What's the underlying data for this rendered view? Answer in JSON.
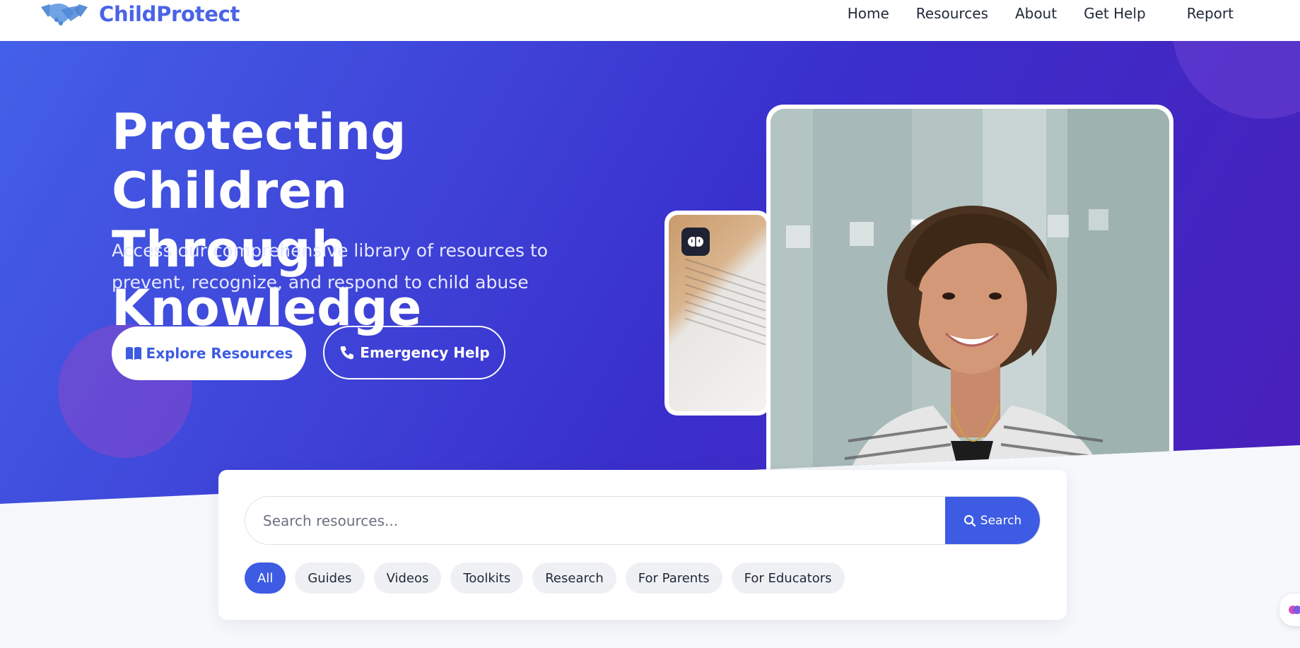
{
  "header": {
    "brand_name": "ChildProtect",
    "logo_icon": "handshake-icon",
    "nav": [
      {
        "label": "Home"
      },
      {
        "label": "Resources"
      },
      {
        "label": "About"
      },
      {
        "label": "Get Help"
      },
      {
        "label": "Report"
      }
    ]
  },
  "hero": {
    "title_line1": "Protecting Children",
    "title_line2": "Through Knowledge",
    "subtitle": "Access our comprehensive library of resources to prevent, recognize, and respond to child abuse",
    "explore_label": "Explore Resources",
    "explore_icon": "book-open-icon",
    "emergency_label": "Emergency Help",
    "emergency_icon": "phone-icon",
    "doc_badge_icon": "brain-icon",
    "colors": {
      "gradient_start": "#4460e8",
      "gradient_end": "#4a1fba",
      "accent": "#3d5be3"
    }
  },
  "search": {
    "placeholder": "Search resources...",
    "button_label": "Search",
    "button_icon": "search-icon",
    "filters": [
      {
        "label": "All",
        "active": true
      },
      {
        "label": "Guides",
        "active": false
      },
      {
        "label": "Videos",
        "active": false
      },
      {
        "label": "Toolkits",
        "active": false
      },
      {
        "label": "Research",
        "active": false
      },
      {
        "label": "For Parents",
        "active": false
      },
      {
        "label": "For Educators",
        "active": false
      }
    ]
  },
  "widget": {
    "icon": "brain-icon"
  }
}
